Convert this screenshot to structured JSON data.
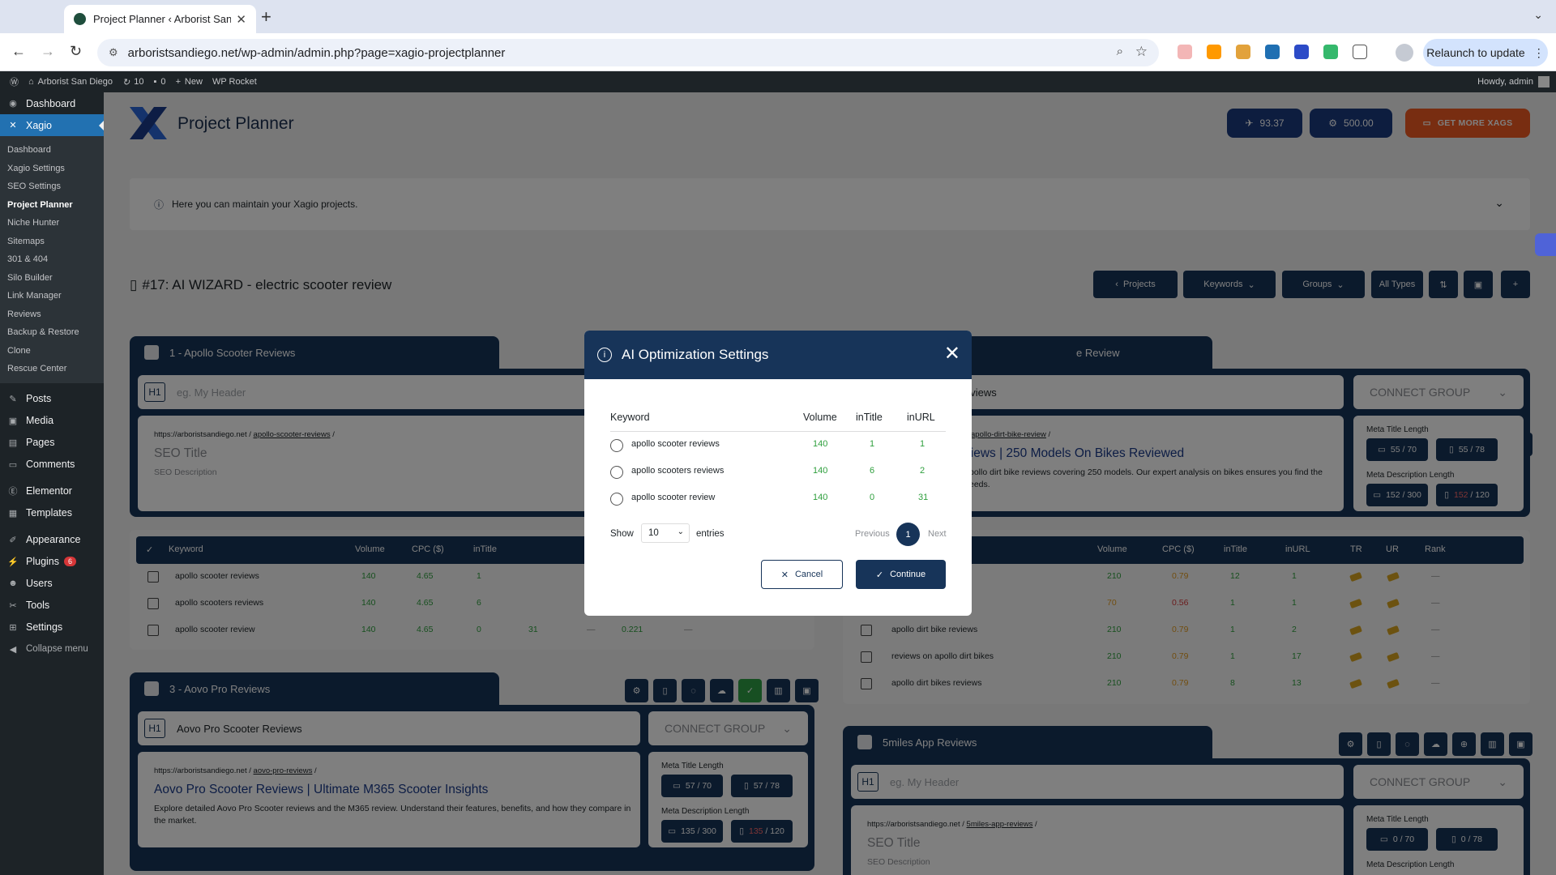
{
  "browser": {
    "tab_title": "Project Planner ‹ Arborist San Diego",
    "url": "arboristsandiego.net/wp-admin/admin.php?page=xagio-projectplanner",
    "relaunch": "Relaunch to update"
  },
  "adminbar": {
    "site": "Arborist San Diego",
    "updates": "10",
    "comments": "0",
    "new": "New",
    "rocket": "WP Rocket",
    "howdy": "Howdy, admin"
  },
  "sidebar": {
    "dashboard": "Dashboard",
    "xagio": "Xagio",
    "sub": [
      "Dashboard",
      "Xagio Settings",
      "SEO Settings",
      "Project Planner",
      "Niche Hunter",
      "Sitemaps",
      "301 & 404",
      "Silo Builder",
      "Link Manager",
      "Reviews",
      "Backup & Restore",
      "Clone",
      "Rescue Center"
    ],
    "posts": "Posts",
    "media": "Media",
    "pages": "Pages",
    "comments": "Comments",
    "elementor": "Elementor",
    "templates": "Templates",
    "appearance": "Appearance",
    "plugins": "Plugins",
    "plugins_badge": "6",
    "users": "Users",
    "tools": "Tools",
    "settings": "Settings",
    "collapse": "Collapse menu"
  },
  "header": {
    "title": "Project Planner",
    "credits1": "93.37",
    "credits2": "500.00",
    "get_more": "GET MORE XAGS"
  },
  "info": {
    "text": "Here you can maintain your Xagio projects."
  },
  "project": {
    "title": "#17: AI WIZARD - electric scooter review",
    "btn_projects": "Projects",
    "btn_keywords": "Keywords",
    "btn_groups": "Groups",
    "btn_alltypes": "All Types"
  },
  "group1": {
    "name": "1 - Apollo Scooter Reviews",
    "h1_placeholder": "eg. My Header",
    "url_base": "https://arboristsandiego.net",
    "url_slug": "apollo-scooter-reviews",
    "seo_title": "SEO Title",
    "seo_desc": "SEO Description",
    "cols": [
      "Keyword",
      "Volume",
      "CPC ($)",
      "inTitle"
    ],
    "rows": [
      {
        "kw": "apollo scooter reviews",
        "vol": "140",
        "cpc": "4.65",
        "intitle": "1"
      },
      {
        "kw": "apollo scooters reviews",
        "vol": "140",
        "cpc": "4.65",
        "intitle": "6"
      },
      {
        "kw": "apollo scooter review",
        "vol": "140",
        "cpc": "4.65",
        "intitle": "0",
        "inurl": "31",
        "dash": "—",
        "tr": "0.221"
      }
    ]
  },
  "group2": {
    "name_suffix": "e Review",
    "h1_fragment": "eviews",
    "connect": "CONNECT GROUP",
    "url_slug": "apollo-dirt-bike-review",
    "seo_title_fragment": "views | 250 Models On Bikes Reviewed",
    "seo_desc_fragment1": "pollo dirt bike reviews covering 250 models. Our expert analysis on bikes ensures you find the",
    "seo_desc_fragment2": "eeds.",
    "meta_title_label": "Meta Title Length",
    "meta_desc_label": "Meta Description Length",
    "mt_desktop": "55 / 70",
    "mt_mobile": "55 / 78",
    "md_desktop": "152 / 300",
    "md_mobile_over": "152",
    "md_mobile_max": " / 120",
    "cols": [
      "Volume",
      "CPC ($)",
      "inTitle",
      "inURL",
      "TR",
      "UR",
      "Rank"
    ],
    "rows": [
      {
        "kw": "",
        "vol": "210",
        "cpc": "0.79",
        "intitle": "12",
        "inurl": "1",
        "rank": "—"
      },
      {
        "kw": "view",
        "vol": "70",
        "cpc": "0.56",
        "intitle": "1",
        "inurl": "1",
        "rank": "—"
      },
      {
        "kw": "apollo dirt bike reviews",
        "vol": "210",
        "cpc": "0.79",
        "intitle": "1",
        "inurl": "2",
        "rank": "—"
      },
      {
        "kw": "reviews on apollo dirt bikes",
        "vol": "210",
        "cpc": "0.79",
        "intitle": "1",
        "inurl": "17",
        "rank": "—"
      },
      {
        "kw": "apollo dirt bikes reviews",
        "vol": "210",
        "cpc": "0.79",
        "intitle": "8",
        "inurl": "13",
        "rank": "—"
      }
    ]
  },
  "group3": {
    "name": "3 - Aovo Pro Reviews",
    "h1": "Aovo Pro Scooter Reviews",
    "connect": "CONNECT GROUP",
    "url_base": "https://arboristsandiego.net",
    "url_slug": "aovo-pro-reviews",
    "seo_title": "Aovo Pro Scooter Reviews | Ultimate M365 Scooter Insights",
    "seo_desc": "Explore detailed Aovo Pro Scooter reviews and the M365 review. Understand their features, benefits, and how they compare in the market.",
    "meta_title_label": "Meta Title Length",
    "meta_desc_label": "Meta Description Length",
    "mt_desktop": "57 / 70",
    "mt_mobile": "57 / 78",
    "md_desktop": "135 / 300",
    "md_mobile_over": "135",
    "md_mobile_max": " / 120"
  },
  "group4": {
    "name": "5miles App Reviews",
    "h1_placeholder": "eg. My Header",
    "connect": "CONNECT GROUP",
    "url_base": "https://arboristsandiego.net",
    "url_slug": "5miles-app-reviews",
    "seo_title": "SEO Title",
    "seo_desc": "SEO Description",
    "meta_title_label": "Meta Title Length",
    "meta_desc_label": "Meta Description Length",
    "mt_desktop": "0 / 70",
    "mt_mobile": "0 / 78"
  },
  "modal": {
    "title": "AI Optimization Settings",
    "cols": {
      "keyword": "Keyword",
      "volume": "Volume",
      "intitle": "inTitle",
      "inurl": "inURL"
    },
    "rows": [
      {
        "kw": "apollo scooter reviews",
        "vol": "140",
        "intitle": "1",
        "inurl": "1"
      },
      {
        "kw": "apollo scooters reviews",
        "vol": "140",
        "intitle": "6",
        "inurl": "2"
      },
      {
        "kw": "apollo scooter review",
        "vol": "140",
        "intitle": "0",
        "inurl": "31"
      }
    ],
    "show": "Show",
    "entries_value": "10",
    "entries": "entries",
    "previous": "Previous",
    "page": "1",
    "next": "Next",
    "cancel": "Cancel",
    "continue": "Continue"
  },
  "colors": {
    "navy": "#173459",
    "accent_orange": "#f05a22",
    "wp_blue": "#2271b1",
    "green": "#2e9f3d"
  }
}
